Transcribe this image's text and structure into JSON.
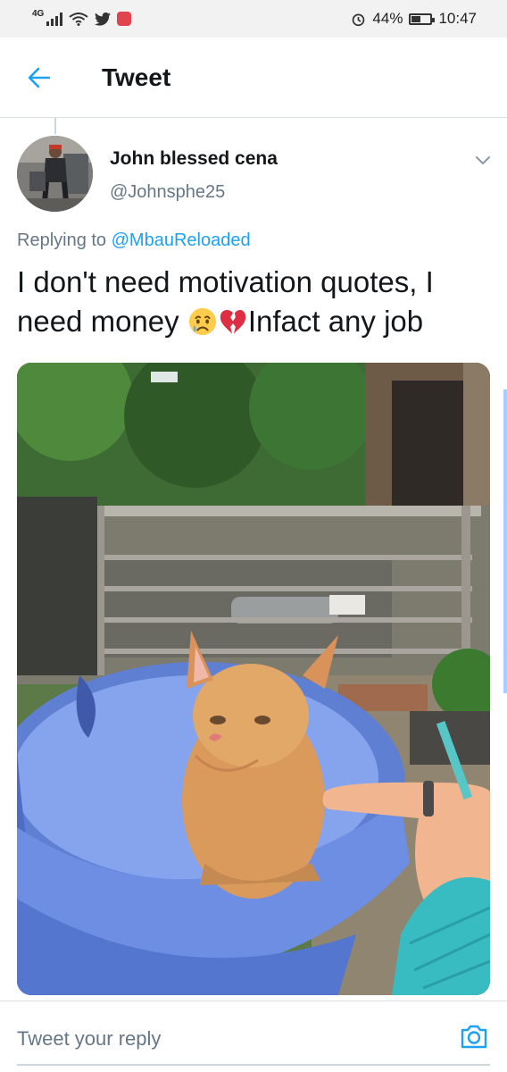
{
  "status_bar": {
    "network": "4G",
    "battery_percent": "44%",
    "time": "10:47",
    "battery_level": 0.44,
    "icons": [
      "signal-icon",
      "wifi-icon",
      "twitter-icon",
      "app-notification-icon",
      "alarm-icon",
      "battery-icon"
    ]
  },
  "app_bar": {
    "title": "Tweet",
    "back_icon": "arrow-left-icon",
    "accent": "#1da1f2"
  },
  "tweet": {
    "author_name": "John blessed cena",
    "author_handle": "@Johnsphe25",
    "replying_prefix": "Replying to",
    "replying_to": "@MbauReloaded",
    "text_part1": "I don't need motivation quotes, I need money ",
    "text_part2": "Infact any job",
    "emojis": [
      "sad-relieved-face-emoji",
      "broken-heart-emoji"
    ],
    "menu_icon": "chevron-down-icon",
    "media_description_icon": "photo-kitten-in-basin"
  },
  "reply": {
    "placeholder": "Tweet your reply",
    "camera_icon": "camera-icon"
  },
  "colors": {
    "text_primary": "#14171a",
    "text_secondary": "#657786",
    "link": "#1da1f2",
    "divider": "#d9dfe3"
  }
}
